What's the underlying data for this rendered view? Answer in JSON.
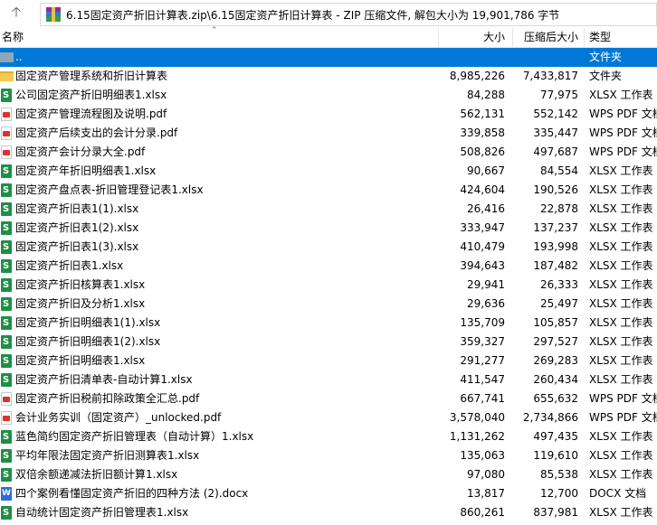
{
  "address": "6.15固定资产折旧计算表.zip\\6.15固定资产折旧计算表 - ZIP 压缩文件, 解包大小为 19,901,786 字节",
  "columns": {
    "name": "名称",
    "size": "大小",
    "compressed": "压缩后大小",
    "type": "类型"
  },
  "rows": [
    {
      "name": "..",
      "size": "",
      "compressed": "",
      "type": "文件夹",
      "icon": "up",
      "selected": true
    },
    {
      "name": "固定资产管理系统和折旧计算表",
      "size": "8,985,226",
      "compressed": "7,433,817",
      "type": "文件夹",
      "icon": "folder"
    },
    {
      "name": "公司固定资产折旧明细表1.xlsx",
      "size": "84,288",
      "compressed": "77,975",
      "type": "XLSX 工作表",
      "icon": "xlsx"
    },
    {
      "name": "固定资产管理流程图及说明.pdf",
      "size": "562,131",
      "compressed": "552,142",
      "type": "WPS PDF 文档",
      "icon": "pdf"
    },
    {
      "name": "固定资产后续支出的会计分录.pdf",
      "size": "339,858",
      "compressed": "335,447",
      "type": "WPS PDF 文档",
      "icon": "pdf"
    },
    {
      "name": "固定资产会计分录大全.pdf",
      "size": "508,826",
      "compressed": "497,687",
      "type": "WPS PDF 文档",
      "icon": "pdf"
    },
    {
      "name": "固定资产年折旧明细表1.xlsx",
      "size": "90,667",
      "compressed": "84,554",
      "type": "XLSX 工作表",
      "icon": "xlsx"
    },
    {
      "name": "固定资产盘点表-折旧管理登记表1.xlsx",
      "size": "424,604",
      "compressed": "190,526",
      "type": "XLSX 工作表",
      "icon": "xlsx"
    },
    {
      "name": "固定资产折旧表1(1).xlsx",
      "size": "26,416",
      "compressed": "22,878",
      "type": "XLSX 工作表",
      "icon": "xlsx"
    },
    {
      "name": "固定资产折旧表1(2).xlsx",
      "size": "333,947",
      "compressed": "137,237",
      "type": "XLSX 工作表",
      "icon": "xlsx"
    },
    {
      "name": "固定资产折旧表1(3).xlsx",
      "size": "410,479",
      "compressed": "193,998",
      "type": "XLSX 工作表",
      "icon": "xlsx"
    },
    {
      "name": "固定资产折旧表1.xlsx",
      "size": "394,643",
      "compressed": "187,482",
      "type": "XLSX 工作表",
      "icon": "xlsx"
    },
    {
      "name": "固定资产折旧核算表1.xlsx",
      "size": "29,941",
      "compressed": "26,333",
      "type": "XLSX 工作表",
      "icon": "xlsx"
    },
    {
      "name": "固定资产折旧及分析1.xlsx",
      "size": "29,636",
      "compressed": "25,497",
      "type": "XLSX 工作表",
      "icon": "xlsx"
    },
    {
      "name": "固定资产折旧明细表1(1).xlsx",
      "size": "135,709",
      "compressed": "105,857",
      "type": "XLSX 工作表",
      "icon": "xlsx"
    },
    {
      "name": "固定资产折旧明细表1(2).xlsx",
      "size": "359,327",
      "compressed": "297,527",
      "type": "XLSX 工作表",
      "icon": "xlsx"
    },
    {
      "name": "固定资产折旧明细表1.xlsx",
      "size": "291,277",
      "compressed": "269,283",
      "type": "XLSX 工作表",
      "icon": "xlsx"
    },
    {
      "name": "固定资产折旧清单表-自动计算1.xlsx",
      "size": "411,547",
      "compressed": "260,434",
      "type": "XLSX 工作表",
      "icon": "xlsx"
    },
    {
      "name": "固定资产折旧税前扣除政策全汇总.pdf",
      "size": "667,741",
      "compressed": "655,632",
      "type": "WPS PDF 文档",
      "icon": "pdf"
    },
    {
      "name": "会计业务实训（固定资产）_unlocked.pdf",
      "size": "3,578,040",
      "compressed": "2,734,866",
      "type": "WPS PDF 文档",
      "icon": "pdf"
    },
    {
      "name": "蓝色简约固定资产折旧管理表（自动计算）1.xlsx",
      "size": "1,131,262",
      "compressed": "497,435",
      "type": "XLSX 工作表",
      "icon": "xlsx"
    },
    {
      "name": "平均年限法固定资产折旧测算表1.xlsx",
      "size": "135,063",
      "compressed": "119,610",
      "type": "XLSX 工作表",
      "icon": "xlsx"
    },
    {
      "name": "双倍余额递减法折旧额计算1.xlsx",
      "size": "97,080",
      "compressed": "85,538",
      "type": "XLSX 工作表",
      "icon": "xlsx"
    },
    {
      "name": "四个案例看懂固定资产折旧的四种方法 (2).docx",
      "size": "13,817",
      "compressed": "12,700",
      "type": "DOCX 文档",
      "icon": "docx"
    },
    {
      "name": "自动统计固定资产折旧管理表1.xlsx",
      "size": "860,261",
      "compressed": "837,981",
      "type": "XLSX 工作表",
      "icon": "xlsx"
    }
  ]
}
